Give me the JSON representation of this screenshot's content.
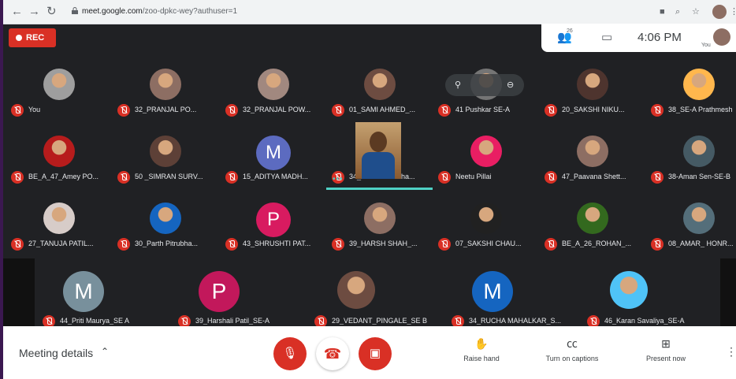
{
  "browser": {
    "url_host": "meet.google.com",
    "url_path": "/zoo-dpkc-wey?authuser=1",
    "icons": [
      "back-icon",
      "forward-icon",
      "reload-icon",
      "lock-icon",
      "cast-icon",
      "zoom-icon",
      "star-icon",
      "extension-icon",
      "menu-icon"
    ]
  },
  "rec": {
    "label": "REC"
  },
  "infobar": {
    "participant_count": "26",
    "time": "4:06 PM",
    "you_label": "You"
  },
  "hover_controls": [
    "pin-icon",
    "mute-icon"
  ],
  "grid": [
    [
      {
        "name": "You",
        "avatar": "photo",
        "color": "#9e9e9e"
      },
      {
        "name": "32_PRANJAL PO...",
        "avatar": "photo",
        "color": "#8d6e63"
      },
      {
        "name": "32_PRANJAL POW...",
        "avatar": "photo",
        "color": "#a1887f"
      },
      {
        "name": "01_SAMI AHMED_...",
        "avatar": "photo",
        "color": "#6d4c41"
      },
      {
        "name": "41 Pushkar SE-A",
        "avatar": "photo",
        "color": "#757575"
      },
      {
        "name": "20_SAKSHI NIKU...",
        "avatar": "photo",
        "color": "#4e342e"
      },
      {
        "name": "38_SE-A Prathmesh",
        "avatar": "photo",
        "color": "#ffb74d"
      }
    ],
    [
      {
        "name": "BE_A_47_Amey PO...",
        "avatar": "photo",
        "color": "#b71c1c"
      },
      {
        "name": "50 _SIMRAN SURV...",
        "avatar": "photo",
        "color": "#5d4037"
      },
      {
        "name": "15_ADITYA MADH...",
        "avatar": "letter",
        "letter": "M",
        "color": "#5c6bc0"
      },
      {
        "name": "34_Abhishek Raha...",
        "avatar": "video",
        "color": "#b07a3c"
      },
      {
        "name": "Neetu Pillai",
        "avatar": "photo",
        "color": "#e91e63"
      },
      {
        "name": "47_Paavana Shett...",
        "avatar": "photo",
        "color": "#8d6e63"
      },
      {
        "name": "38-Aman Sen-SE-B",
        "avatar": "photo",
        "color": "#455a64"
      }
    ],
    [
      {
        "name": "27_TANUJA PATIL...",
        "avatar": "photo",
        "color": "#d7ccc8"
      },
      {
        "name": "30_Parth Pitrubha...",
        "avatar": "photo",
        "color": "#1565c0"
      },
      {
        "name": "43_SHRUSHTI PAT...",
        "avatar": "letter",
        "letter": "P",
        "color": "#d81b60"
      },
      {
        "name": "39_HARSH SHAH_...",
        "avatar": "photo",
        "color": "#8d6e63"
      },
      {
        "name": "07_SAKSHI CHAU...",
        "avatar": "photo",
        "color": "#212121"
      },
      {
        "name": "BE_A_26_ROHAN_...",
        "avatar": "photo",
        "color": "#33691e"
      },
      {
        "name": "08_AMAR_ HONR...",
        "avatar": "photo",
        "color": "#546e7a"
      }
    ],
    [
      {
        "name": "44_Priti Maurya_SE A",
        "avatar": "letter",
        "letter": "M",
        "color": "#78909c"
      },
      {
        "name": "39_Harshali Patil_SE-A",
        "avatar": "letter",
        "letter": "P",
        "color": "#c2185b"
      },
      {
        "name": "29_VEDANT_PINGALE_SE B",
        "avatar": "photo",
        "color": "#6d4c41"
      },
      {
        "name": "34_RUCHA MAHALKAR_S...",
        "avatar": "letter",
        "letter": "M",
        "color": "#1565c0"
      },
      {
        "name": "46_Karan Savaliya_SE-A",
        "avatar": "photo",
        "color": "#4fc3f7"
      }
    ]
  ],
  "bottom": {
    "meeting_details": "Meeting details",
    "raise_hand": "Raise hand",
    "captions": "Turn on captions",
    "present": "Present now"
  }
}
